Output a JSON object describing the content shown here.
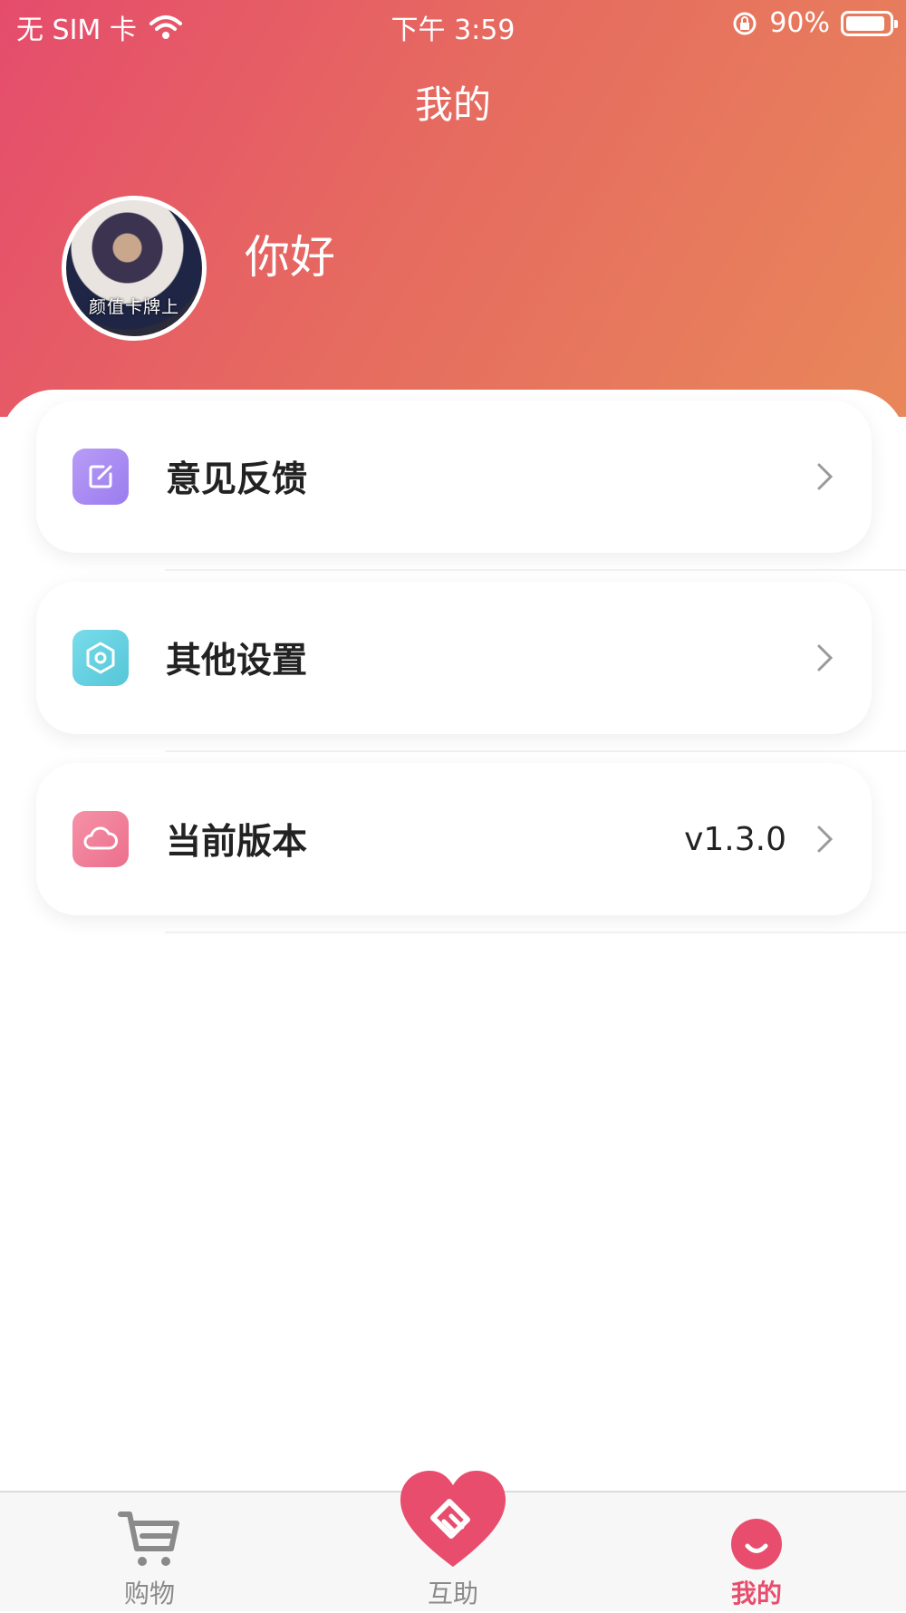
{
  "status_bar": {
    "carrier": "无 SIM 卡",
    "time": "下午 3:59",
    "battery": "90%"
  },
  "header": {
    "title": "我的",
    "greeting": "你好",
    "avatar_caption": "颜值卡牌上"
  },
  "menu": {
    "items": [
      {
        "label": "意见反馈",
        "value": "",
        "icon": "edit-icon",
        "color": "#a98af2"
      },
      {
        "label": "其他设置",
        "value": "",
        "icon": "settings-icon",
        "color": "#66d2e2"
      },
      {
        "label": "当前版本",
        "value": "v1.3.0",
        "icon": "cloud-icon",
        "color": "#f07f98"
      }
    ]
  },
  "tab_bar": {
    "tabs": [
      {
        "label": "购物",
        "icon": "cart-icon",
        "active": false
      },
      {
        "label": "互助",
        "icon": "heart-handshake-icon",
        "active": false
      },
      {
        "label": "我的",
        "icon": "smile-icon",
        "active": true
      }
    ]
  },
  "colors": {
    "header_gradient_start": "#e54c6c",
    "header_gradient_end": "#e8875a",
    "accent": "#e84d6d"
  }
}
